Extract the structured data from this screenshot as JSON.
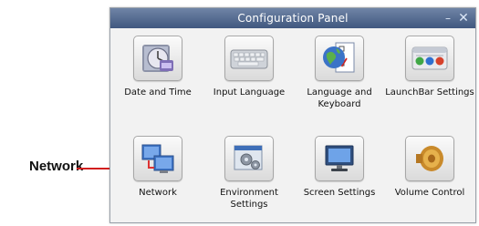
{
  "callout": {
    "label": "Network"
  },
  "window": {
    "title": "Configuration Panel",
    "minimize_glyph": "–",
    "close_glyph": "✕"
  },
  "items": [
    {
      "label": "Date and Time",
      "icon": "clock-calendar-icon"
    },
    {
      "label": "Input Language",
      "icon": "keyboard-icon"
    },
    {
      "label": "Language and Keyboard",
      "icon": "globe-checklist-icon"
    },
    {
      "label": "LaunchBar Settings",
      "icon": "launchbar-icon"
    },
    {
      "label": "Network",
      "icon": "network-computers-icon"
    },
    {
      "label": "Environment Settings",
      "icon": "gears-window-icon"
    },
    {
      "label": "Screen Settings",
      "icon": "monitor-icon"
    },
    {
      "label": "Volume Control",
      "icon": "speaker-icon"
    }
  ],
  "colors": {
    "titlebar_top": "#6f84a6",
    "titlebar_bottom": "#41587f",
    "callout_line": "#d21e1e"
  }
}
